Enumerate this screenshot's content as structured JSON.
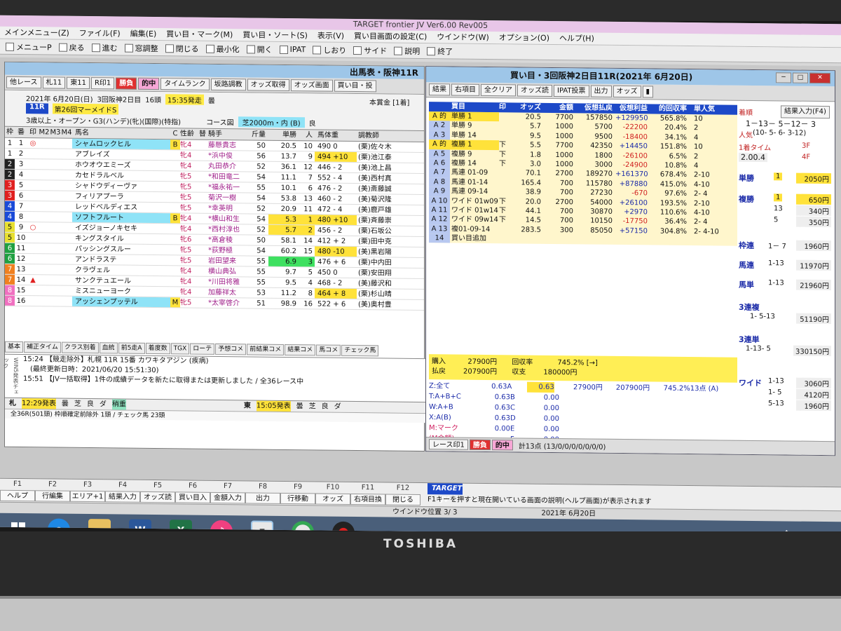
{
  "window": {
    "title": "TARGET frontier JV  Ver6.00  Rev005"
  },
  "menu": [
    "メインメニュー(Z)",
    "ファイル(F)",
    "編集(E)",
    "買い目・マーク(M)",
    "買い目・ソート(S)",
    "表示(V)",
    "買い目画面の設定(C)",
    "ウインドウ(W)",
    "オプション(O)",
    "ヘルプ(H)"
  ],
  "toolbar": [
    "メニューP",
    "戻る",
    "進む",
    "窓調整",
    "閉じる",
    "最小化",
    "開く",
    "IPAT",
    "しおり",
    "サイド",
    "説明",
    "終了"
  ],
  "left": {
    "title": "出馬表・阪神11R",
    "buttons": [
      "他レース",
      "札11",
      "東11",
      "R印1",
      "勝負",
      "的中",
      "タイムランク",
      "坂路調教",
      "オッズ取得",
      "オッズ画面",
      "買い目・投"
    ],
    "race": {
      "date": "2021年 6月20日(日)",
      "kai": "3回阪神2日目",
      "heads": "16頭",
      "start": "15:35発走",
      "weather": "曇",
      "rno": "11R",
      "name": "第26回マーメイドS",
      "cls": "3歳以上・オープン・G3(ハンデ)(牝)(国際)(特指)",
      "course_label": "コース図",
      "course": "芝2000m・内 (B)",
      "going": "良",
      "prize": "本賞金 [1着]"
    },
    "headers": [
      "枠",
      "番",
      "印",
      "M2",
      "M3",
      "M4",
      "馬名",
      "C",
      "性齢",
      "替",
      "騎手",
      "斤量",
      "単勝",
      "人",
      "馬体重",
      "調教師"
    ],
    "rows": [
      {
        "w": "1",
        "n": "1",
        "m": "◎",
        "name": "シャムロックヒル",
        "c": "B",
        "s": "牝4",
        "j": "藤懸貴志",
        "k": "50",
        "o": "20.5",
        "p": "10",
        "b": "490  0",
        "t": "(栗)佐々木"
      },
      {
        "w": "1",
        "n": "2",
        "m": "",
        "name": "アブレイズ",
        "c": "",
        "s": "牝4",
        "j": "*浜中俊",
        "k": "56",
        "o": "13.7",
        "p": "9",
        "b": "494 +10",
        "t": "(栗)池江泰"
      },
      {
        "w": "2",
        "n": "3",
        "m": "",
        "name": "ホウオウエミーズ",
        "c": "",
        "s": "牝4",
        "j": "丸田恭介",
        "k": "52",
        "o": "36.1",
        "p": "12",
        "b": "446 - 2",
        "t": "(美)池上昌"
      },
      {
        "w": "2",
        "n": "4",
        "m": "",
        "name": "カセドラルベル",
        "c": "",
        "s": "牝5",
        "j": "*和田竜二",
        "k": "54",
        "o": "11.1",
        "p": "7",
        "b": "552 - 4",
        "t": "(美)西村真"
      },
      {
        "w": "3",
        "n": "5",
        "m": "",
        "name": "シャドウディーヴァ",
        "c": "",
        "s": "牝5",
        "j": "*福永祐一",
        "k": "55",
        "o": "10.1",
        "p": "6",
        "b": "476 - 2",
        "t": "(美)斎藤誠"
      },
      {
        "w": "3",
        "n": "6",
        "m": "",
        "name": "フィリアプーラ",
        "c": "",
        "s": "牝5",
        "j": "菊沢一樹",
        "k": "54",
        "o": "53.8",
        "p": "13",
        "b": "460 - 2",
        "t": "(美)菊沢隆"
      },
      {
        "w": "4",
        "n": "7",
        "m": "",
        "name": "レッドベルディエス",
        "c": "",
        "s": "牝5",
        "j": "*幸英明",
        "k": "52",
        "o": "20.9",
        "p": "11",
        "b": "472 - 4",
        "t": "(美)鹿戸雄"
      },
      {
        "w": "4",
        "n": "8",
        "m": "",
        "name": "ソフトフルート",
        "c": "B",
        "s": "牝4",
        "j": "*横山和生",
        "k": "54",
        "o": "5.3",
        "p": "1",
        "b": "480 +10",
        "t": "(栗)斉藤崇"
      },
      {
        "w": "5",
        "n": "9",
        "m": "○",
        "name": "イズジョーノキセキ",
        "c": "",
        "s": "牝4",
        "j": "*西村淳也",
        "k": "52",
        "o": "5.7",
        "p": "2",
        "b": "456 - 2",
        "t": "(栗)石坂公"
      },
      {
        "w": "5",
        "n": "10",
        "m": "",
        "name": "キングスタイル",
        "c": "",
        "s": "牝6",
        "j": "*高倉稜",
        "k": "50",
        "o": "58.1",
        "p": "14",
        "b": "412 + 2",
        "t": "(栗)田中克"
      },
      {
        "w": "6",
        "n": "11",
        "m": "",
        "name": "パッシングスルー",
        "c": "",
        "s": "牝5",
        "j": "*荻野極",
        "k": "54",
        "o": "60.2",
        "p": "15",
        "b": "480 -10",
        "t": "(美)黒岩陽"
      },
      {
        "w": "6",
        "n": "12",
        "m": "",
        "name": "アンドラステ",
        "c": "",
        "s": "牝5",
        "j": "岩田望来",
        "k": "55",
        "o": "6.9",
        "p": "3",
        "b": "476 + 6",
        "t": "(栗)中内田"
      },
      {
        "w": "7",
        "n": "13",
        "m": "",
        "name": "クラヴェル",
        "c": "",
        "s": "牝4",
        "j": "横山典弘",
        "k": "55",
        "o": "9.7",
        "p": "5",
        "b": "450  0",
        "t": "(栗)安田翔"
      },
      {
        "w": "7",
        "n": "14",
        "m": "▲",
        "name": "サンクテュエール",
        "c": "",
        "s": "牝4",
        "j": "*川田将雅",
        "k": "55",
        "o": "9.5",
        "p": "4",
        "b": "468 - 2",
        "t": "(美)藤沢和"
      },
      {
        "w": "8",
        "n": "15",
        "m": "",
        "name": "ミスニューヨーク",
        "c": "",
        "s": "牝4",
        "j": "加藤祥太",
        "k": "53",
        "o": "11.2",
        "p": "8",
        "b": "464 + 8",
        "t": "(栗)杉山晴"
      },
      {
        "w": "8",
        "n": "16",
        "m": "",
        "name": "アッシェンプッテル",
        "c": "M",
        "s": "牝5",
        "j": "*太宰啓介",
        "k": "51",
        "o": "98.9",
        "p": "16",
        "b": "522 + 6",
        "t": "(美)奥村豊"
      }
    ],
    "tabs": [
      "基本",
      "補正タイム",
      "クラス別着",
      "血統",
      "前5走A",
      "着度数",
      "TGX",
      "ローテ",
      "予想コメ",
      "前結果コメ",
      "結果コメ",
      "馬コメ",
      "チェック馬"
    ],
    "news_side": "WIN5発表チェック",
    "news": [
      "15:24 【競走除外】札幌 11R 15番 カワキタアジン (疾病)",
      "(最終更新日時：2021/06/20 15:51:30)",
      "15:51 【JV一括取得】1件の成績データを新たに取得または更新しました / 全36レース中"
    ],
    "stat1": [
      "札",
      "12:29発表",
      "曇",
      "芝",
      "良",
      "ダ",
      "稍重",
      "東",
      "15:05発表",
      "曇",
      "芝",
      "良",
      "ダ"
    ],
    "stat2": "全36R(501頭) 枠順確定前除外 1頭 / チェック馬 23頭"
  },
  "right": {
    "title": "買い目・3回阪神2日目11R(2021年 6月20日)",
    "buttons": [
      "結果",
      "右項目",
      "全クリア",
      "オッズ読",
      "IPAT投票",
      "出力",
      "オッズ"
    ],
    "headers": [
      "",
      "買目",
      "印",
      "オッズ",
      "金額",
      "仮想払戻",
      "仮想利益",
      "的回収率",
      "単人気"
    ],
    "rows": [
      {
        "l": "A 的",
        "t": "単勝 1",
        "m": "",
        "o": "20.5",
        "a": "7700",
        "r": "157850",
        "p": "+129950",
        "rt": "565.8%",
        "pop": "10",
        "hl": true
      },
      {
        "l": "A 2",
        "t": "単勝 9",
        "m": "",
        "o": "5.7",
        "a": "1000",
        "r": "5700",
        "p": "-22200",
        "rt": "20.4%",
        "pop": "2"
      },
      {
        "l": "A 3",
        "t": "単勝 14",
        "m": "",
        "o": "9.5",
        "a": "1000",
        "r": "9500",
        "p": "-18400",
        "rt": "34.1%",
        "pop": "4"
      },
      {
        "l": "A 的",
        "t": "複勝 1",
        "m": "下",
        "o": "5.5",
        "a": "7700",
        "r": "42350",
        "p": "+14450",
        "rt": "151.8%",
        "pop": "10",
        "hl": true
      },
      {
        "l": "A 5",
        "t": "複勝 9",
        "m": "下",
        "o": "1.8",
        "a": "1000",
        "r": "1800",
        "p": "-26100",
        "rt": "6.5%",
        "pop": "2"
      },
      {
        "l": "A 6",
        "t": "複勝 14",
        "m": "下",
        "o": "3.0",
        "a": "1000",
        "r": "3000",
        "p": "-24900",
        "rt": "10.8%",
        "pop": "4"
      },
      {
        "l": "A 7",
        "t": "馬連 01-09",
        "m": "",
        "o": "70.1",
        "a": "2700",
        "r": "189270",
        "p": "+161370",
        "rt": "678.4%",
        "pop": "2-10"
      },
      {
        "l": "A 8",
        "t": "馬連 01-14",
        "m": "",
        "o": "165.4",
        "a": "700",
        "r": "115780",
        "p": "+87880",
        "rt": "415.0%",
        "pop": "4-10"
      },
      {
        "l": "A 9",
        "t": "馬連 09-14",
        "m": "",
        "o": "38.9",
        "a": "700",
        "r": "27230",
        "p": "-670",
        "rt": "97.6%",
        "pop": "2- 4"
      },
      {
        "l": "A 10",
        "t": "ワイド 01w09",
        "m": "下",
        "o": "20.0",
        "a": "2700",
        "r": "54000",
        "p": "+26100",
        "rt": "193.5%",
        "pop": "2-10"
      },
      {
        "l": "A 11",
        "t": "ワイド 01w14",
        "m": "下",
        "o": "44.1",
        "a": "700",
        "r": "30870",
        "p": "+2970",
        "rt": "110.6%",
        "pop": "4-10"
      },
      {
        "l": "A 12",
        "t": "ワイド 09w14",
        "m": "下",
        "o": "14.5",
        "a": "700",
        "r": "10150",
        "p": "-17750",
        "rt": "36.4%",
        "pop": "2- 4"
      },
      {
        "l": "A 13",
        "t": "複01-09-14",
        "m": "",
        "o": "283.5",
        "a": "300",
        "r": "85050",
        "p": "+57150",
        "rt": "304.8%",
        "pop": "2- 4-10"
      },
      {
        "l": "14",
        "t": "買い目追加",
        "m": "",
        "o": "",
        "a": "",
        "r": "",
        "p": "",
        "rt": "",
        "pop": ""
      }
    ],
    "summary": {
      "buy_l": "購入",
      "buy": "27900円",
      "ret_l": "回収率",
      "ret": "745.2%",
      "arrow": "[→]",
      "pay_l": "払戻",
      "pay": "207900円",
      "bal_l": "収支",
      "bal": "180000円"
    },
    "z": [
      {
        "k": "Z:全て",
        "v": "0.63",
        "g": "A",
        "gv": "0.63",
        "a": "27900円",
        "b": "207900円",
        "c": "745.2%",
        "d": "13点 (A)"
      },
      {
        "k": "T:A+B+C",
        "v": "0.63",
        "g": "B",
        "gv": "0.00"
      },
      {
        "k": "W:A+B",
        "v": "0.63",
        "g": "C",
        "gv": "0.00"
      },
      {
        "k": "X:A(B)",
        "v": "0.63",
        "g": "D",
        "gv": "0.00"
      },
      {
        "k": "M:マーク",
        "v": "0.00",
        "g": "E",
        "gv": "0.00"
      },
      {
        "k": "(M金額)",
        "v": "",
        "g": "F",
        "gv": "0.00"
      }
    ],
    "foot": [
      "レース印1",
      "勝負",
      "的中",
      "計13点 (13/0/0/0/0/0/0/0)"
    ],
    "side": {
      "order_l": "着順",
      "result_btn": "結果入力(F4)",
      "order": "1－13－ 5－12－ 3",
      "pop_l": "人気",
      "pop": "(10- 5- 6- 3-12)",
      "time_l": "1着タイム",
      "time": "2.00.4",
      "f3": "3F",
      "f4": "4F",
      "tan_l": "単勝",
      "tan_n": "1",
      "tan_v": "2050円",
      "fuku_l": "複勝",
      "fuku": [
        [
          "1",
          "650円"
        ],
        [
          "13",
          "340円"
        ],
        [
          "5",
          "350円"
        ]
      ],
      "waku_l": "枠連",
      "waku_n": "1－ 7",
      "waku_v": "1960円",
      "umaren_l": "馬連",
      "umaren_n": "1-13",
      "umaren_v": "11970円",
      "umatan_l": "馬単",
      "umatan_n": "1-13",
      "umatan_v": "21960円",
      "sanfuku_l": "3連複",
      "sanfuku_n": "1- 5-13",
      "sanfuku_v": "51190円",
      "santan_l": "3連単",
      "santan_n": "1-13- 5",
      "santan_v": "330150円",
      "wide_l": "ワイド",
      "wide": [
        [
          "1-13",
          "3060円"
        ],
        [
          "1- 5",
          "4120円"
        ],
        [
          "5-13",
          "1960円"
        ]
      ]
    }
  },
  "fkeys": {
    "keys": [
      "F1",
      "F2",
      "F3",
      "F4",
      "F5",
      "F6",
      "F7",
      "F8",
      "F9",
      "F10",
      "F11",
      "F12"
    ],
    "labels": [
      "ヘルプ",
      "行編集",
      "エリア+1",
      "結果入力",
      "オッズ読",
      "買い目入",
      "金額入力",
      "出力",
      "行移動",
      "オッズ",
      "右項目換",
      "閉じる"
    ],
    "logo": "TARGET JV",
    "hint": "F1キーを押すと現在開いている画面の説明(ヘルプ画面)が表示されます"
  },
  "status": {
    "pos": "ウインドウ位置 3/ 3",
    "date": "2021年 6月20日"
  },
  "taskbar": [
    "W",
    "X",
    "J",
    "T"
  ],
  "tray": "A",
  "brand": "TOSHIBA",
  "colors": {
    "waku": [
      "#ffffff",
      "#ffffff",
      "#000000",
      "#000000",
      "#e02020",
      "#e02020",
      "#1a4ad8",
      "#1a4ad8",
      "#e8e030",
      "#e8e030",
      "#20a040",
      "#20a040",
      "#f08020",
      "#f08020",
      "#f070c0",
      "#f070c0"
    ]
  }
}
